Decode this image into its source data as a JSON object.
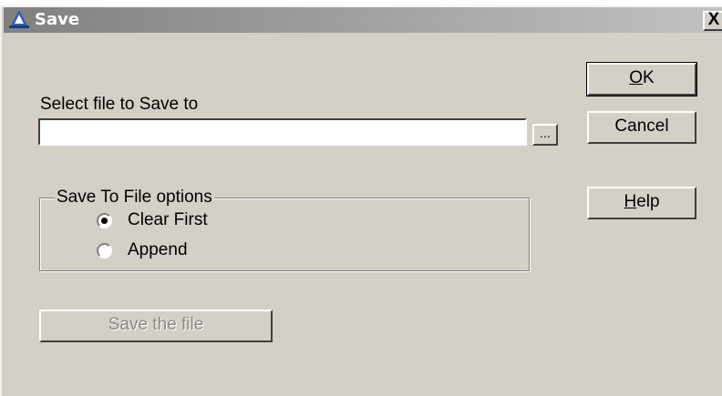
{
  "window": {
    "title": "Save",
    "close_label": "X"
  },
  "file_select": {
    "label": "Select file to Save to",
    "value": "",
    "browse_label": "..."
  },
  "options": {
    "legend": "Save To File options",
    "items": [
      {
        "label": "Clear First",
        "selected": true
      },
      {
        "label": "Append",
        "selected": false
      }
    ]
  },
  "buttons": {
    "ok": {
      "mnemonic": "O",
      "rest": "K"
    },
    "cancel": "Cancel",
    "help": {
      "mnemonic": "H",
      "rest": "elp"
    },
    "save_file": "Save the file"
  },
  "icons": {
    "title_icon": "app-a-icon"
  }
}
